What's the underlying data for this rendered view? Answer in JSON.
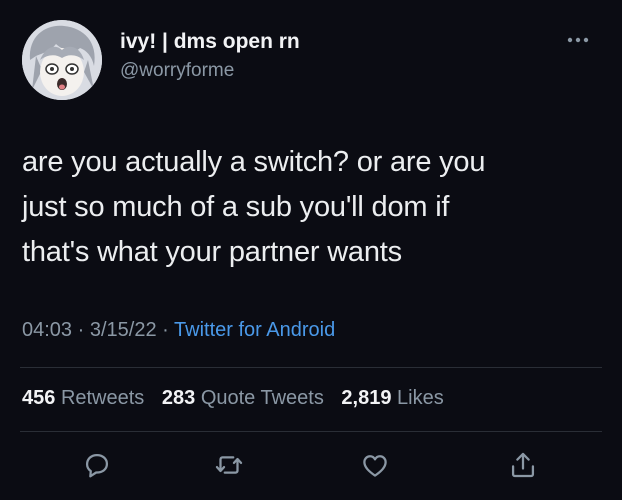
{
  "user": {
    "display_name": "ivy! | dms open rn",
    "handle": "@worryforme",
    "avatar_icon": "anime-avatar"
  },
  "tweet": {
    "text_lines": [
      "are you actually a switch? or are you",
      "just so much of a sub you'll dom if",
      "that's what your partner wants"
    ],
    "time": "04:03",
    "date": "3/15/22",
    "separator": "·",
    "source": "Twitter for Android"
  },
  "stats": {
    "retweets_count": "456",
    "retweets_label": "Retweets",
    "quote_count": "283",
    "quote_label": "Quote Tweets",
    "likes_count": "2,819",
    "likes_label": "Likes"
  },
  "actions": [
    "reply-icon",
    "retweet-icon",
    "like-icon",
    "share-icon"
  ],
  "colors": {
    "background": "#0b0c13",
    "text": "#eceef0",
    "secondary": "#8b98a5",
    "link": "#4a99e9",
    "divider": "#2a2e36"
  }
}
